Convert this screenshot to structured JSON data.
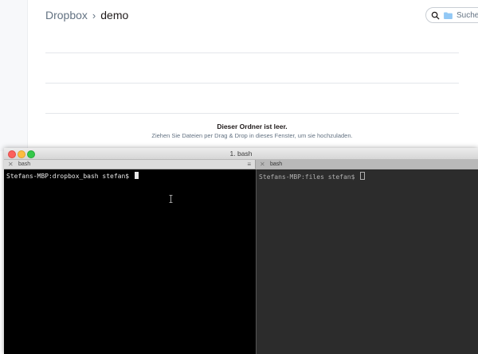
{
  "dropbox": {
    "breadcrumb": {
      "root": "Dropbox",
      "separator": "›",
      "current": "demo"
    },
    "search": {
      "placeholder": "Suchen"
    },
    "empty_state": {
      "title": "Dieser Ordner ist leer.",
      "subtitle": "Ziehen Sie Dateien per Drag & Drop in dieses Fenster, um sie hochzuladen."
    }
  },
  "terminal": {
    "window_title": "1. bash",
    "tabs": [
      {
        "label": "bash",
        "close": "✕"
      },
      {
        "label": "bash",
        "close": "✕"
      }
    ],
    "tab_menu_icon": "≡",
    "panes": [
      {
        "prompt": "Stefans-MBP:dropbox_bash stefan$ "
      },
      {
        "prompt": "Stefans-MBP:files stefan$ "
      }
    ]
  }
}
